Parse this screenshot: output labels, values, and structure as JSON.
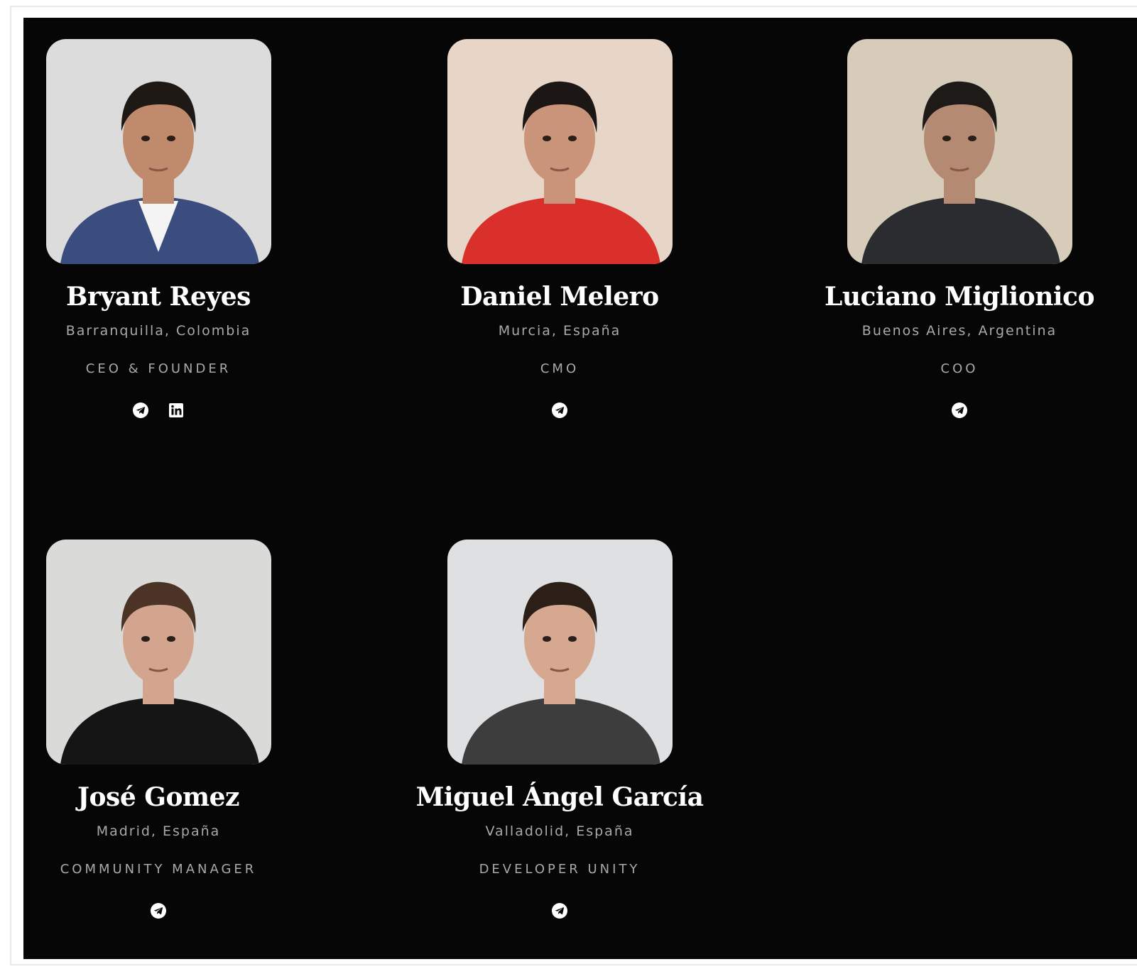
{
  "team": [
    {
      "name": "Bryant Reyes",
      "location": "Barranquilla, Colombia",
      "role": "CEO & FOUNDER",
      "socials": [
        "telegram-icon",
        "linkedin-icon"
      ],
      "photo": {
        "bg": "#dcdcdc",
        "skin": "#c08a6c",
        "hair": "#1e1915",
        "shirt": "#3b4c7e",
        "inner": "#f4f4f4"
      }
    },
    {
      "name": "Daniel Melero",
      "location": "Murcia, España",
      "role": "CMO",
      "socials": [
        "telegram-icon"
      ],
      "photo": {
        "bg": "#e7d6c8",
        "skin": "#c99479",
        "hair": "#1c1714",
        "shirt": "#d9302c",
        "inner": "#d9302c"
      }
    },
    {
      "name": "Luciano Miglionico",
      "location": "Buenos Aires, Argentina",
      "role": "COO",
      "socials": [
        "telegram-icon"
      ],
      "photo": {
        "bg": "#d6ccb9",
        "skin": "#b48a72",
        "hair": "#1d1a18",
        "shirt": "#2b2c2f",
        "inner": "#2b2c2f"
      }
    },
    {
      "name": "José Gomez",
      "location": "Madrid, España",
      "role": "COMMUNITY MANAGER",
      "socials": [
        "telegram-icon"
      ],
      "photo": {
        "bg": "#dadad8",
        "skin": "#d4a58e",
        "hair": "#4b3425",
        "shirt": "#151515",
        "inner": "#151515"
      }
    },
    {
      "name": "Miguel Ángel García",
      "location": "Valladolid, España",
      "role": "DEVELOPER UNITY",
      "socials": [
        "telegram-icon"
      ],
      "photo": {
        "bg": "#dfe0e2",
        "skin": "#d5a88f",
        "hair": "#2c1f17",
        "shirt": "#3c3d3c",
        "inner": "#3c3d3c"
      }
    }
  ]
}
